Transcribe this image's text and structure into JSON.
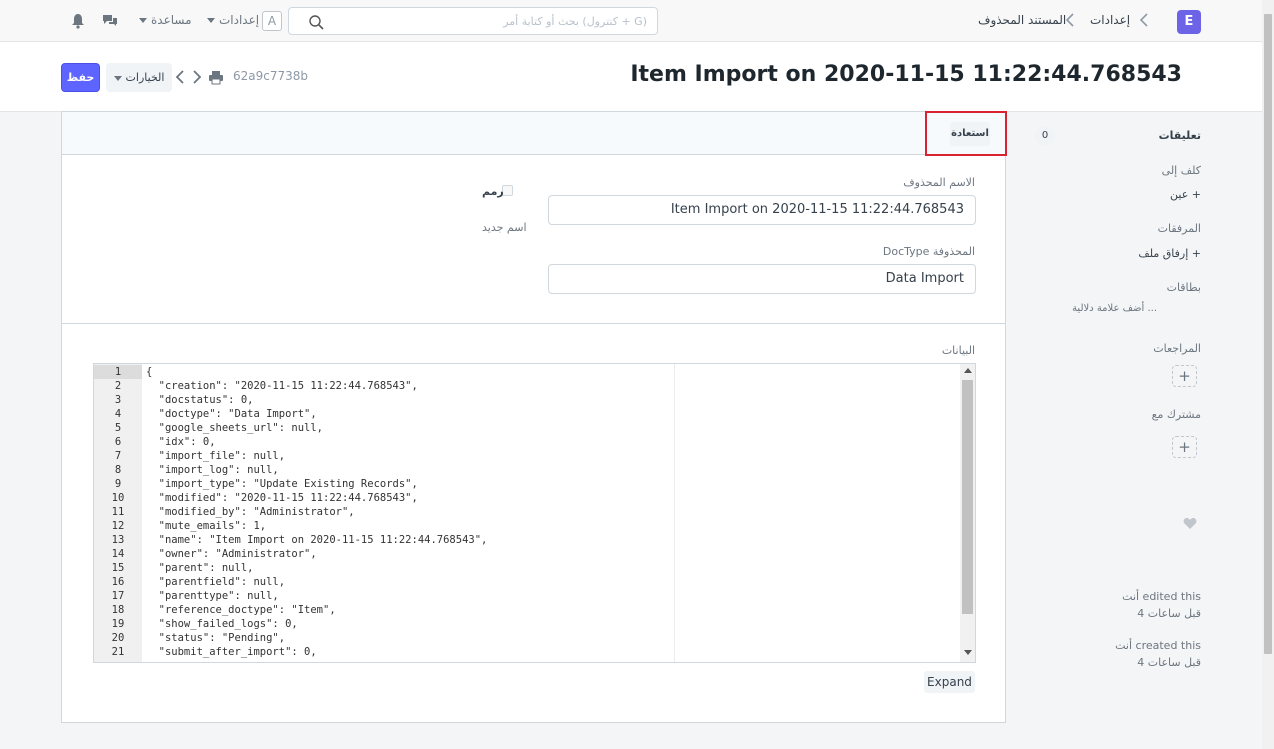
{
  "navbar": {
    "brand_letter": "E",
    "breadcrumbs": [
      "إعدادات",
      "المستند المحذوف"
    ],
    "search_placeholder": "بحث أو كتابة أمر (كنترول + G)",
    "settings_label": "إعدادات",
    "help_label": "مساعدة",
    "avatar_letter": "A"
  },
  "header": {
    "title": "Item Import on 2020-11-15 11:22:44.768543",
    "save_label": "حفظ",
    "options_label": "الخيارات",
    "doc_name": "62a9c7738b"
  },
  "form": {
    "restore_label": "استعادة",
    "deleted_name_label": "الاسم المحذوف",
    "deleted_name_value": "Item Import on 2020-11-15 11:22:44.768543",
    "deleted_doctype_label": "DocType المحذوفة",
    "deleted_doctype_value": "Data Import",
    "amended_label": "رمم",
    "new_name_label": "اسم جديد",
    "data_label": "البيانات",
    "expand_label": "Expand"
  },
  "editor": {
    "lines": [
      "{",
      "  \"creation\": \"2020-11-15 11:22:44.768543\",",
      "  \"docstatus\": 0,",
      "  \"doctype\": \"Data Import\",",
      "  \"google_sheets_url\": null,",
      "  \"idx\": 0,",
      "  \"import_file\": null,",
      "  \"import_log\": null,",
      "  \"import_type\": \"Update Existing Records\",",
      "  \"modified\": \"2020-11-15 11:22:44.768543\",",
      "  \"modified_by\": \"Administrator\",",
      "  \"mute_emails\": 1,",
      "  \"name\": \"Item Import on 2020-11-15 11:22:44.768543\",",
      "  \"owner\": \"Administrator\",",
      "  \"parent\": null,",
      "  \"parentfield\": null,",
      "  \"parenttype\": null,",
      "  \"reference_doctype\": \"Item\",",
      "  \"show_failed_logs\": 0,",
      "  \"status\": \"Pending\",",
      "  \"submit_after_import\": 0,"
    ],
    "line_numbers": [
      "1",
      "2",
      "3",
      "4",
      "5",
      "6",
      "7",
      "8",
      "9",
      "10",
      "11",
      "12",
      "13",
      "14",
      "15",
      "16",
      "17",
      "18",
      "19",
      "20",
      "21"
    ]
  },
  "sidebar": {
    "comments_label": "تعليقات",
    "comments_count": "0",
    "assigned_label": "كلف إلى",
    "assign_action": "عين",
    "attachments_label": "المرفقات",
    "attach_action": "إرفاق ملف",
    "tags_label": "بطاقات",
    "add_tag": "أضف علامة دلالية ...",
    "reviews_label": "المراجعات",
    "shared_label": "مشترك مع",
    "activity": [
      {
        "text": "أنت edited this",
        "time": "4 قبل ساعات"
      },
      {
        "text": "أنت created this",
        "time": "4 قبل ساعات"
      }
    ]
  }
}
